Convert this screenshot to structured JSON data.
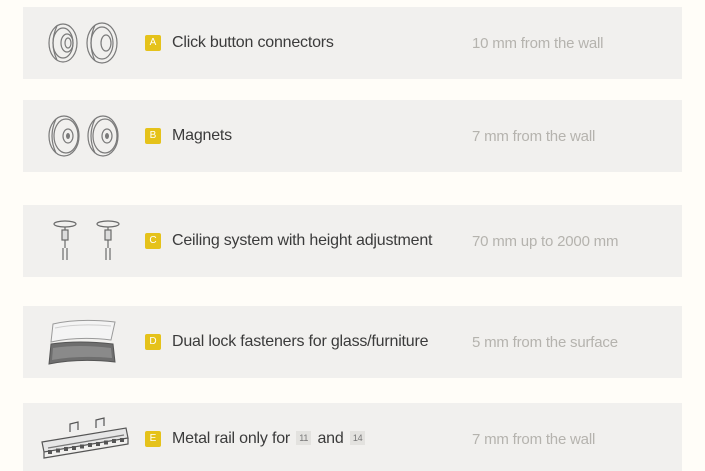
{
  "items": [
    {
      "letter": "A",
      "name": "Click button connectors",
      "note": "10 mm from the wall",
      "icon": "click-button-connectors-icon"
    },
    {
      "letter": "B",
      "name": "Magnets",
      "note": "7 mm from the wall",
      "icon": "magnets-icon"
    },
    {
      "letter": "C",
      "name": "Ceiling system with height adjustment",
      "note": "70 mm up to 2000 mm",
      "icon": "ceiling-system-icon"
    },
    {
      "letter": "D",
      "name": "Dual lock fasteners for glass/furniture",
      "note": "5 mm from the surface",
      "icon": "dual-lock-fastener-icon"
    },
    {
      "letter": "E",
      "name_prefix": "Metal rail only for",
      "ref1": "11",
      "name_mid": "and",
      "ref2": "14",
      "note": "7 mm from the wall",
      "icon": "metal-rail-icon"
    }
  ],
  "colors": {
    "badge": "#e5c21a",
    "row_bg": "#f1f0ee",
    "name": "#3b3b3b",
    "note": "#b5b3ae"
  }
}
